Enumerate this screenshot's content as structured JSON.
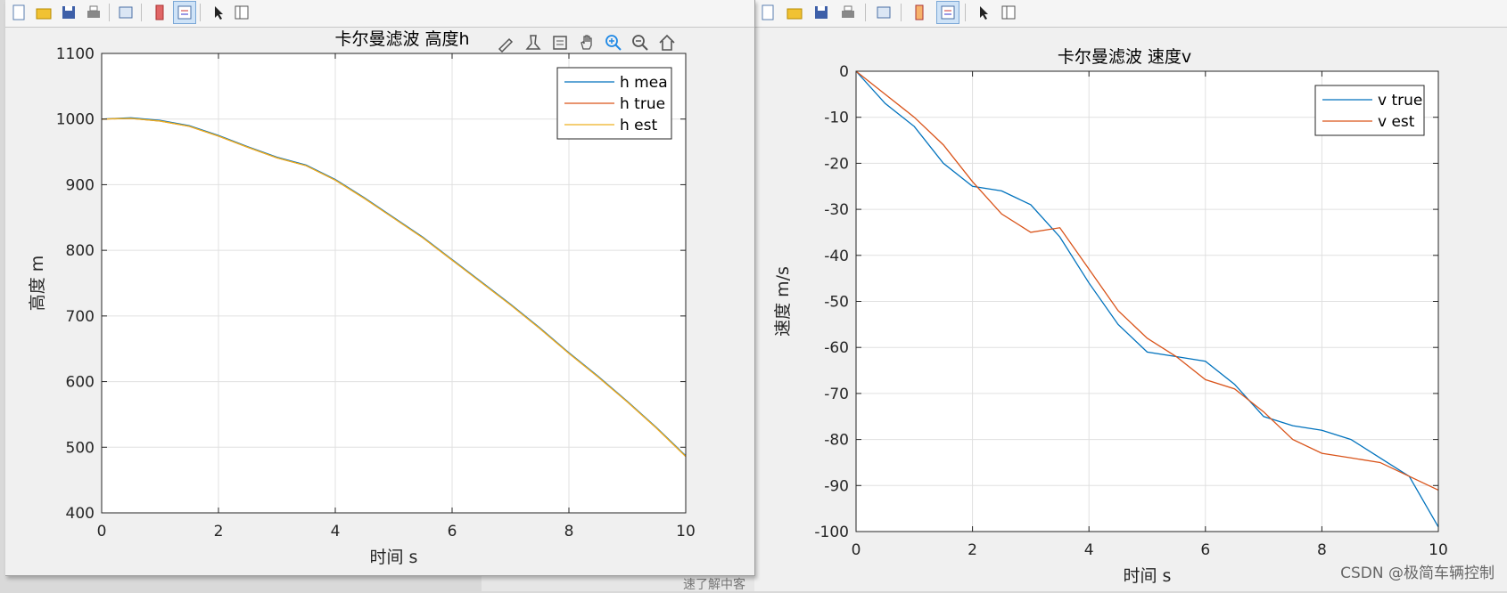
{
  "watermark": "CSDN @极简车辆控制",
  "background_text": "速了解中客",
  "colors": {
    "blue": "#0072bd",
    "orange": "#d95319",
    "yellow": "#edb120",
    "grid": "#e0e0e0",
    "axis": "#262626"
  },
  "toolbar_icons": [
    "new-figure-icon",
    "open-file-icon",
    "save-icon",
    "print-icon",
    "link-plot-icon",
    "insert-colorbar-icon",
    "insert-legend-icon",
    "edit-plot-icon",
    "property-inspector-icon"
  ],
  "axes_toolbar_icons": [
    "brush-icon",
    "data-tips-icon",
    "export-icon",
    "pan-icon",
    "zoom-in-icon",
    "zoom-out-icon",
    "restore-view-icon"
  ],
  "chart_data": [
    {
      "type": "line",
      "title": "卡尔曼滤波 高度h",
      "xlabel": "时间 s",
      "ylabel": "高度  m",
      "xlim": [
        0,
        10
      ],
      "ylim": [
        400,
        1100
      ],
      "xticks": [
        0,
        2,
        4,
        6,
        8,
        10
      ],
      "yticks": [
        400,
        500,
        600,
        700,
        800,
        900,
        1000,
        1100
      ],
      "grid": true,
      "legend_position": "top-right",
      "x": [
        0,
        0.5,
        1,
        1.5,
        2,
        2.5,
        3,
        3.5,
        4,
        4.5,
        5,
        5.5,
        6,
        6.5,
        7,
        7.5,
        8,
        8.5,
        9,
        9.5,
        10
      ],
      "series": [
        {
          "name": "h mea",
          "color": "#0072bd",
          "values": [
            1000,
            1002,
            998,
            990,
            975,
            958,
            942,
            930,
            908,
            880,
            850,
            820,
            786,
            752,
            718,
            682,
            644,
            608,
            570,
            530,
            487
          ]
        },
        {
          "name": "h true",
          "color": "#d95319",
          "values": [
            1000,
            1001,
            997,
            989,
            974,
            957,
            941,
            929,
            907,
            879,
            849,
            819,
            785,
            751,
            717,
            681,
            643,
            607,
            569,
            529,
            486
          ]
        },
        {
          "name": "h est",
          "color": "#edb120",
          "values": [
            1000,
            1001,
            997,
            989,
            974,
            957,
            941,
            929,
            907,
            879,
            849,
            819,
            785,
            751,
            717,
            681,
            643,
            607,
            569,
            529,
            486
          ]
        }
      ]
    },
    {
      "type": "line",
      "title": "卡尔曼滤波 速度v",
      "xlabel": "时间 s",
      "ylabel": "速度  m/s",
      "xlim": [
        0,
        10
      ],
      "ylim": [
        -100,
        0
      ],
      "xticks": [
        0,
        2,
        4,
        6,
        8,
        10
      ],
      "yticks": [
        -100,
        -90,
        -80,
        -70,
        -60,
        -50,
        -40,
        -30,
        -20,
        -10,
        0
      ],
      "grid": true,
      "legend_position": "top-right",
      "x": [
        0,
        0.5,
        1,
        1.5,
        2,
        2.5,
        3,
        3.5,
        4,
        4.5,
        5,
        5.5,
        6,
        6.5,
        7,
        7.5,
        8,
        8.5,
        9,
        9.5,
        10
      ],
      "series": [
        {
          "name": "v true",
          "color": "#0072bd",
          "values": [
            0,
            -7,
            -12,
            -20,
            -25,
            -26,
            -29,
            -36,
            -46,
            -55,
            -61,
            -62,
            -63,
            -68,
            -75,
            -77,
            -78,
            -80,
            -84,
            -88,
            -99
          ]
        },
        {
          "name": "v est",
          "color": "#d95319",
          "values": [
            0,
            -5,
            -10,
            -16,
            -24,
            -31,
            -35,
            -34,
            -43,
            -52,
            -58,
            -62,
            -67,
            -69,
            -74,
            -80,
            -83,
            -84,
            -85,
            -88,
            -91
          ]
        }
      ]
    }
  ]
}
